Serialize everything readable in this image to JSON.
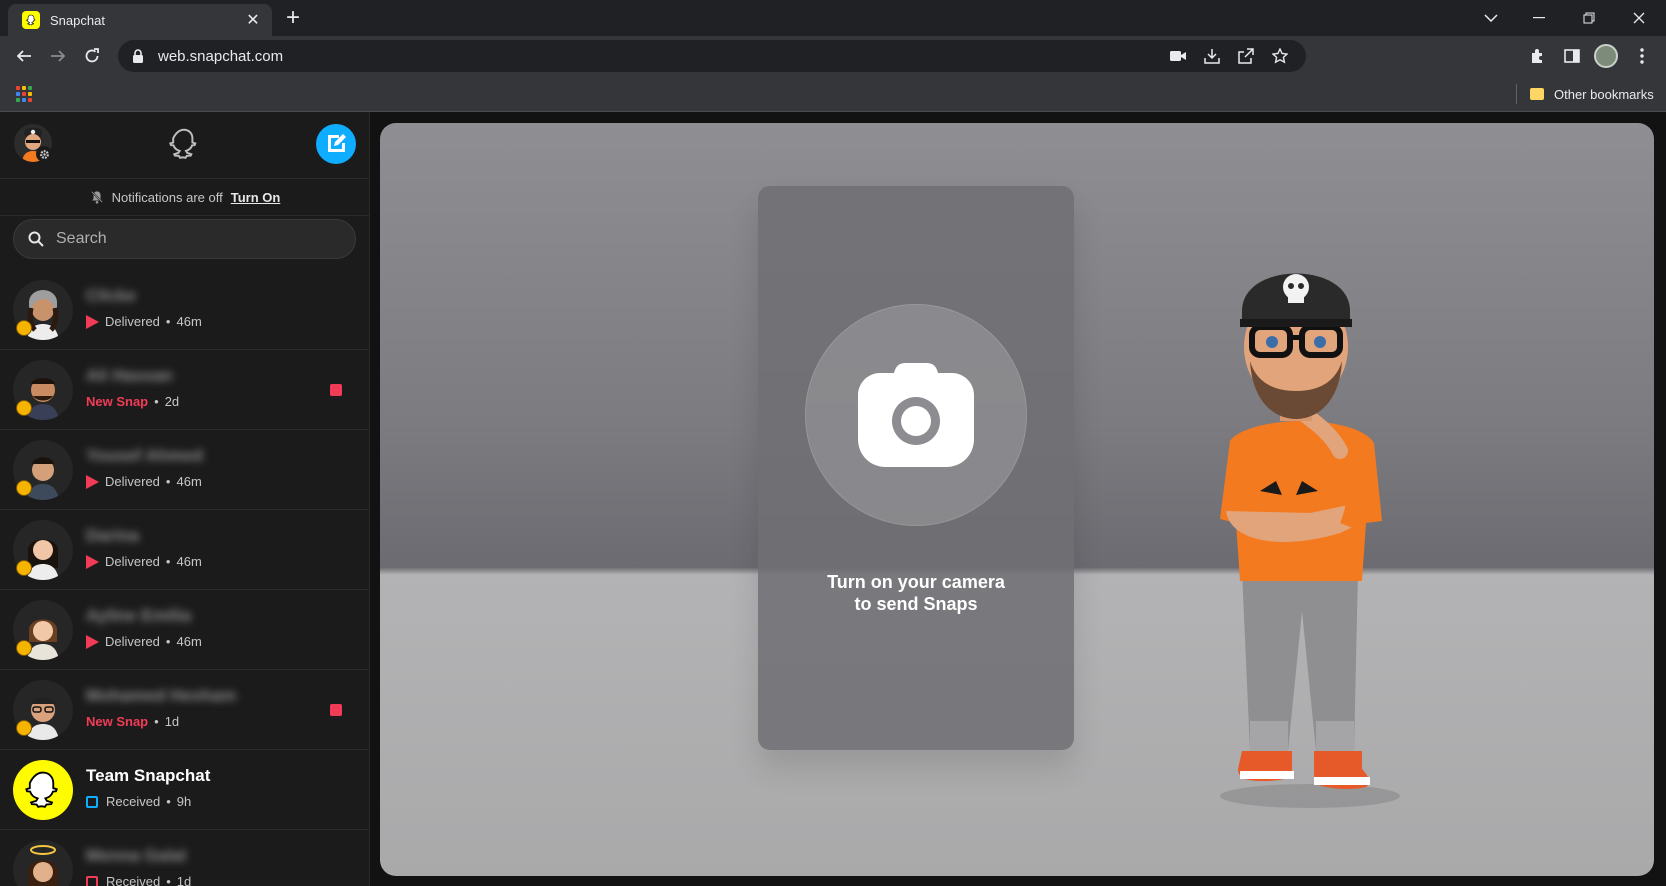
{
  "browser": {
    "tab_title": "Snapchat",
    "url": "web.snapchat.com",
    "bookmarks_other": "Other bookmarks"
  },
  "sidebar": {
    "notification_text": "Notifications are off",
    "notification_link": "Turn On",
    "search_placeholder": "Search",
    "chats": [
      {
        "name": "Clicke",
        "status": "Delivered",
        "time": "46m",
        "type": "delivered",
        "unread": false
      },
      {
        "name": "Ali Hassan",
        "status": "New Snap",
        "time": "2d",
        "type": "new-snap",
        "unread": true
      },
      {
        "name": "Yousef Ahmed",
        "status": "Delivered",
        "time": "46m",
        "type": "delivered",
        "unread": false
      },
      {
        "name": "Darina",
        "status": "Delivered",
        "time": "46m",
        "type": "delivered",
        "unread": false
      },
      {
        "name": "Ayline Emilia",
        "status": "Delivered",
        "time": "46m",
        "type": "delivered",
        "unread": false
      },
      {
        "name": "Mohamed Hesham",
        "status": "New Snap",
        "time": "1d",
        "type": "new-snap",
        "unread": true
      },
      {
        "name": "Team Snapchat",
        "status": "Received",
        "time": "9h",
        "type": "received",
        "unread": false
      },
      {
        "name": "Menna Galal",
        "status": "Received",
        "time": "1d",
        "type": "received",
        "unread": false
      }
    ]
  },
  "camera": {
    "prompt": "Turn on your camera\nto send Snaps"
  },
  "colors": {
    "snap_yellow": "#fffc00",
    "snap_red": "#f23c57",
    "snap_blue": "#0fadff"
  }
}
